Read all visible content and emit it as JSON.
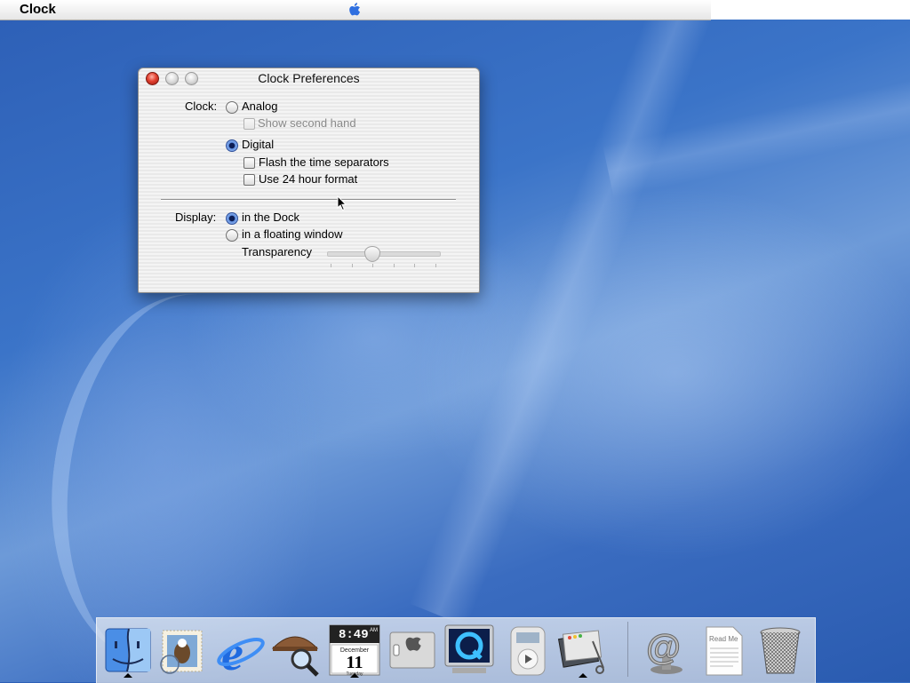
{
  "menubar": {
    "app_name": "Clock",
    "apple_menu_icon": "apple-logo-icon"
  },
  "window": {
    "title": "Clock Preferences",
    "controls": [
      "close",
      "minimize",
      "zoom"
    ],
    "clock_section": {
      "label": "Clock:",
      "analog": {
        "label": "Analog",
        "selected": false
      },
      "show_second_hand": {
        "label": "Show second hand",
        "checked": false,
        "enabled": false
      },
      "digital": {
        "label": "Digital",
        "selected": true
      },
      "flash_separators": {
        "label": "Flash the time separators",
        "checked": false
      },
      "use_24_hour": {
        "label": "Use 24 hour format",
        "checked": false
      }
    },
    "display_section": {
      "label": "Display:",
      "in_dock": {
        "label": "in the Dock",
        "selected": true
      },
      "floating_window": {
        "label": "in a floating window",
        "selected": false
      },
      "transparency": {
        "label": "Transparency",
        "value_fraction": 0.4,
        "enabled": false
      }
    }
  },
  "dock": {
    "apps": [
      {
        "name": "Finder",
        "icon": "finder-icon",
        "running": true
      },
      {
        "name": "Mail",
        "icon": "mail-stamp-icon",
        "running": false
      },
      {
        "name": "Internet Explorer",
        "icon": "internet-explorer-icon",
        "running": false
      },
      {
        "name": "Sherlock",
        "icon": "sherlock-hat-magnifier-icon",
        "running": false
      },
      {
        "name": "Clock",
        "icon": "clock-calendar-icon",
        "running": true,
        "time": "8:49",
        "ampm": "AM",
        "month": "December",
        "day": "11",
        "weekday": "Tuesday"
      },
      {
        "name": "System Preferences",
        "icon": "system-preferences-icon",
        "running": false
      },
      {
        "name": "QuickTime Player",
        "icon": "quicktime-icon",
        "running": false
      },
      {
        "name": "iTunes",
        "icon": "ipod-player-icon",
        "running": false
      },
      {
        "name": "Mac OS X",
        "icon": "desktop-scissors-icon",
        "running": true
      }
    ],
    "documents": [
      {
        "name": "Mail.app alias",
        "icon": "at-sign-icon"
      },
      {
        "name": "Read Me",
        "icon": "read-me-document-icon",
        "text": "Read Me"
      },
      {
        "name": "Trash",
        "icon": "trash-icon"
      }
    ]
  },
  "colors": {
    "desktop": "#3b74c8",
    "close_button": "#e2402f",
    "radio_selected": "#5f8fe0"
  }
}
